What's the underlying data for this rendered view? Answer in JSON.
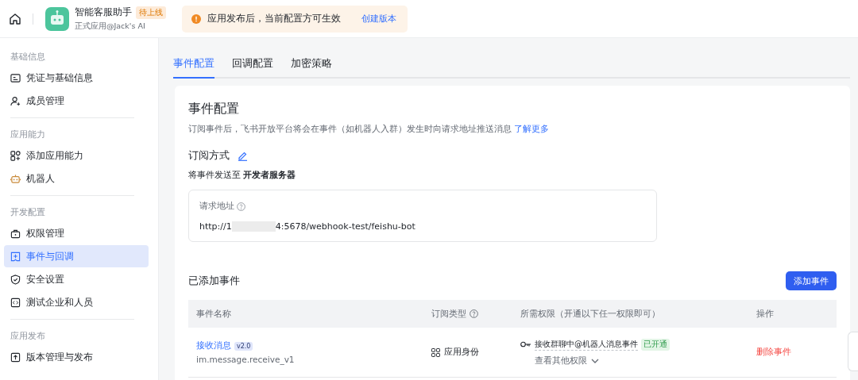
{
  "header": {
    "app_name": "智能客服助手",
    "status_badge": "待上线",
    "app_subtitle": "正式应用@Jack's AI",
    "notice": {
      "text": "应用发布后，当前配置方可生效",
      "link": "创建版本"
    }
  },
  "sidebar": {
    "groups": [
      {
        "title": "基础信息",
        "items": [
          {
            "label": "凭证与基础信息",
            "kind": "card",
            "selected": false
          },
          {
            "label": "成员管理",
            "kind": "person",
            "selected": false
          }
        ]
      },
      {
        "title": "应用能力",
        "items": [
          {
            "label": "添加应用能力",
            "kind": "grid",
            "selected": false
          },
          {
            "label": "机器人",
            "kind": "robot",
            "selected": false
          }
        ]
      },
      {
        "title": "开发配置",
        "items": [
          {
            "label": "权限管理",
            "kind": "lock",
            "selected": false
          },
          {
            "label": "事件与回调",
            "kind": "plusbox",
            "selected": true
          },
          {
            "label": "安全设置",
            "kind": "shield",
            "selected": false
          },
          {
            "label": "测试企业和人员",
            "kind": "code",
            "selected": false
          }
        ]
      },
      {
        "title": "应用发布",
        "items": [
          {
            "label": "版本管理与发布",
            "kind": "upload",
            "selected": false
          }
        ]
      }
    ]
  },
  "tabs": [
    {
      "label": "事件配置",
      "selected": true
    },
    {
      "label": "回调配置",
      "selected": false
    },
    {
      "label": "加密策略",
      "selected": false
    }
  ],
  "card": {
    "title": "事件配置",
    "description": "订阅事件后，飞书开放平台将会在事件（如机器人入群）发生时向请求地址推送消息",
    "learn_more": "了解更多",
    "subscription": {
      "title": "订阅方式",
      "method_prefix": "将事件发送至",
      "method": "开发者服务器",
      "url_label": "请求地址",
      "url_start": "http://1",
      "url_end": "4:5678/webhook-test/feishu-bot"
    },
    "events": {
      "title": "已添加事件",
      "add_button": "添加事件",
      "columns": [
        {
          "label": "事件名称",
          "help": false
        },
        {
          "label": "订阅类型",
          "help": true
        },
        {
          "label": "所需权限（开通以下任一权限即可）",
          "help": false
        },
        {
          "label": "操作",
          "help": false
        }
      ],
      "rows": [
        {
          "name": "接收消息",
          "version": "v2.0",
          "key": "im.message.receive_v1",
          "type": "应用身份",
          "permission": "接收群聊中@机器人消息事件",
          "permission_status": "已开通",
          "more_permissions": "查看其他权限",
          "action": "删除事件"
        }
      ]
    }
  }
}
